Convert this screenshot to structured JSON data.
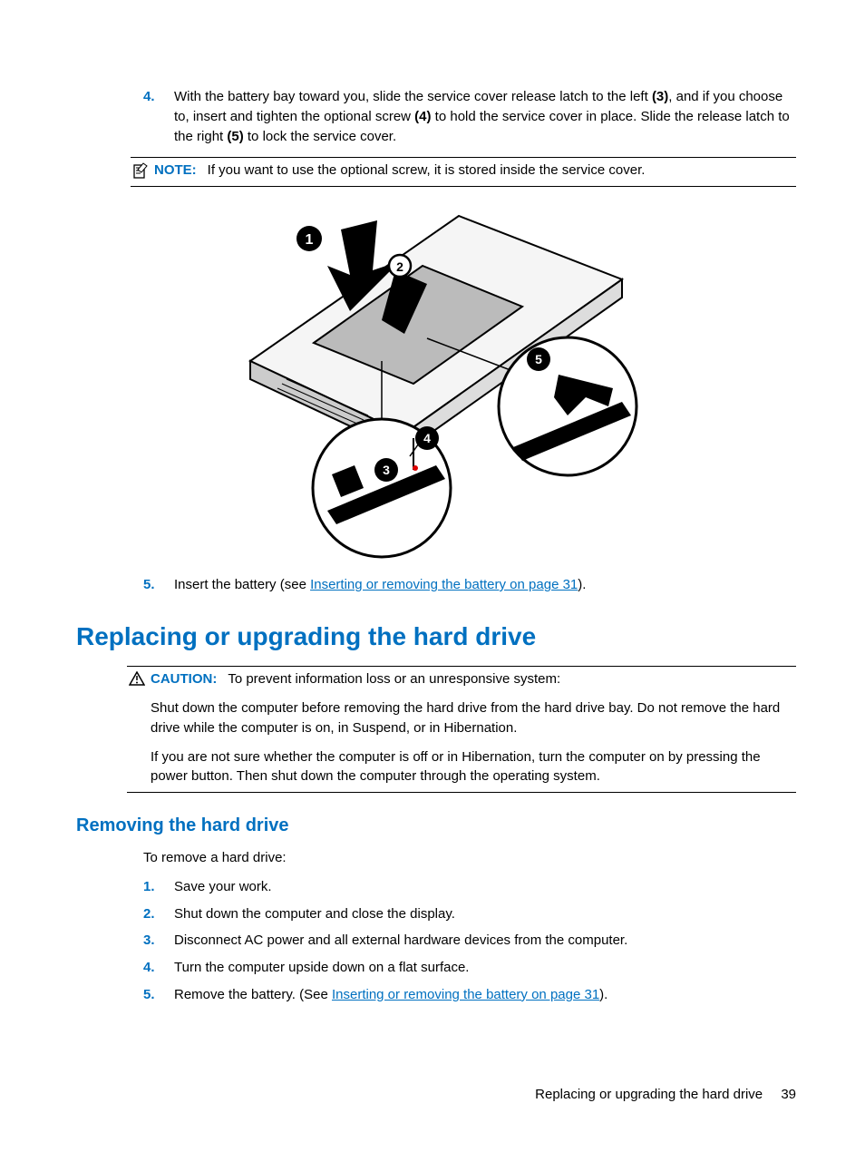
{
  "step4": {
    "num": "4.",
    "pre": "With the battery bay toward you, slide the service cover release latch to the left ",
    "b1": "(3)",
    "mid1": ", and if you choose to, insert and tighten the optional screw ",
    "b2": "(4)",
    "mid2": " to hold the service cover in place. Slide the release latch to the right ",
    "b3": "(5)",
    "post": " to lock the service cover."
  },
  "note": {
    "label": "NOTE:",
    "text": "If you want to use the optional screw, it is stored inside the service cover."
  },
  "illus_callouts": {
    "c1": "1",
    "c2": "2",
    "c3": "3",
    "c4": "4",
    "c5": "5"
  },
  "step5": {
    "num": "5.",
    "pre": "Insert the battery (see ",
    "link": "Inserting or removing the battery on page 31",
    "post": ")."
  },
  "heading1": "Replacing or upgrading the hard drive",
  "caution": {
    "label": "CAUTION:",
    "lead": "To prevent information loss or an unresponsive system:",
    "p1": "Shut down the computer before removing the hard drive from the hard drive bay. Do not remove the hard drive while the computer is on, in Suspend, or in Hibernation.",
    "p2": "If you are not sure whether the computer is off or in Hibernation, turn the computer on by pressing the power button. Then shut down the computer through the operating system."
  },
  "heading2": "Removing the hard drive",
  "intro": "To remove a hard drive:",
  "steps": {
    "s1": {
      "num": "1.",
      "text": "Save your work."
    },
    "s2": {
      "num": "2.",
      "text": "Shut down the computer and close the display."
    },
    "s3": {
      "num": "3.",
      "text": "Disconnect AC power and all external hardware devices from the computer."
    },
    "s4": {
      "num": "4.",
      "text": "Turn the computer upside down on a flat surface."
    },
    "s5": {
      "num": "5.",
      "pre": "Remove the battery. (See ",
      "link": "Inserting or removing the battery on page 31",
      "post": ")."
    }
  },
  "footer": {
    "title": "Replacing or upgrading the hard drive",
    "page": "39"
  }
}
